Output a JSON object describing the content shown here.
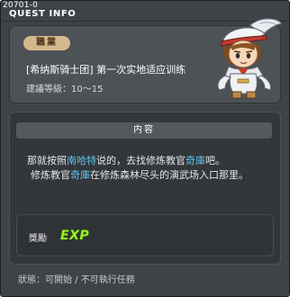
{
  "window": {
    "quest_id": "20701-0",
    "title": "QUEST INFO"
  },
  "quest": {
    "job_tag": "職業",
    "name": "[希纳斯骑士团] 第一次实地适应训练",
    "recommended_level": "建議等級：10～15"
  },
  "content": {
    "header": "内容",
    "line1": {
      "a": "那就按照",
      "b": "南哈特",
      "c": "说的，去找修炼教官",
      "d": "奇庫",
      "e": "吧。"
    },
    "line2": {
      "a": "修炼教官",
      "b": "奇庫",
      "c": "在修炼森林尽头的演武场入口那里。"
    }
  },
  "reward": {
    "label": "獎勵",
    "exp_label": "EXP"
  },
  "status": "狀態：可開始 / 不可執行任務",
  "colors": {
    "highlight": "#5fc6ee",
    "exp": "#9cf02d",
    "tag": "#d5b98d"
  },
  "icons": {
    "npc": "knight-npc-portrait"
  }
}
